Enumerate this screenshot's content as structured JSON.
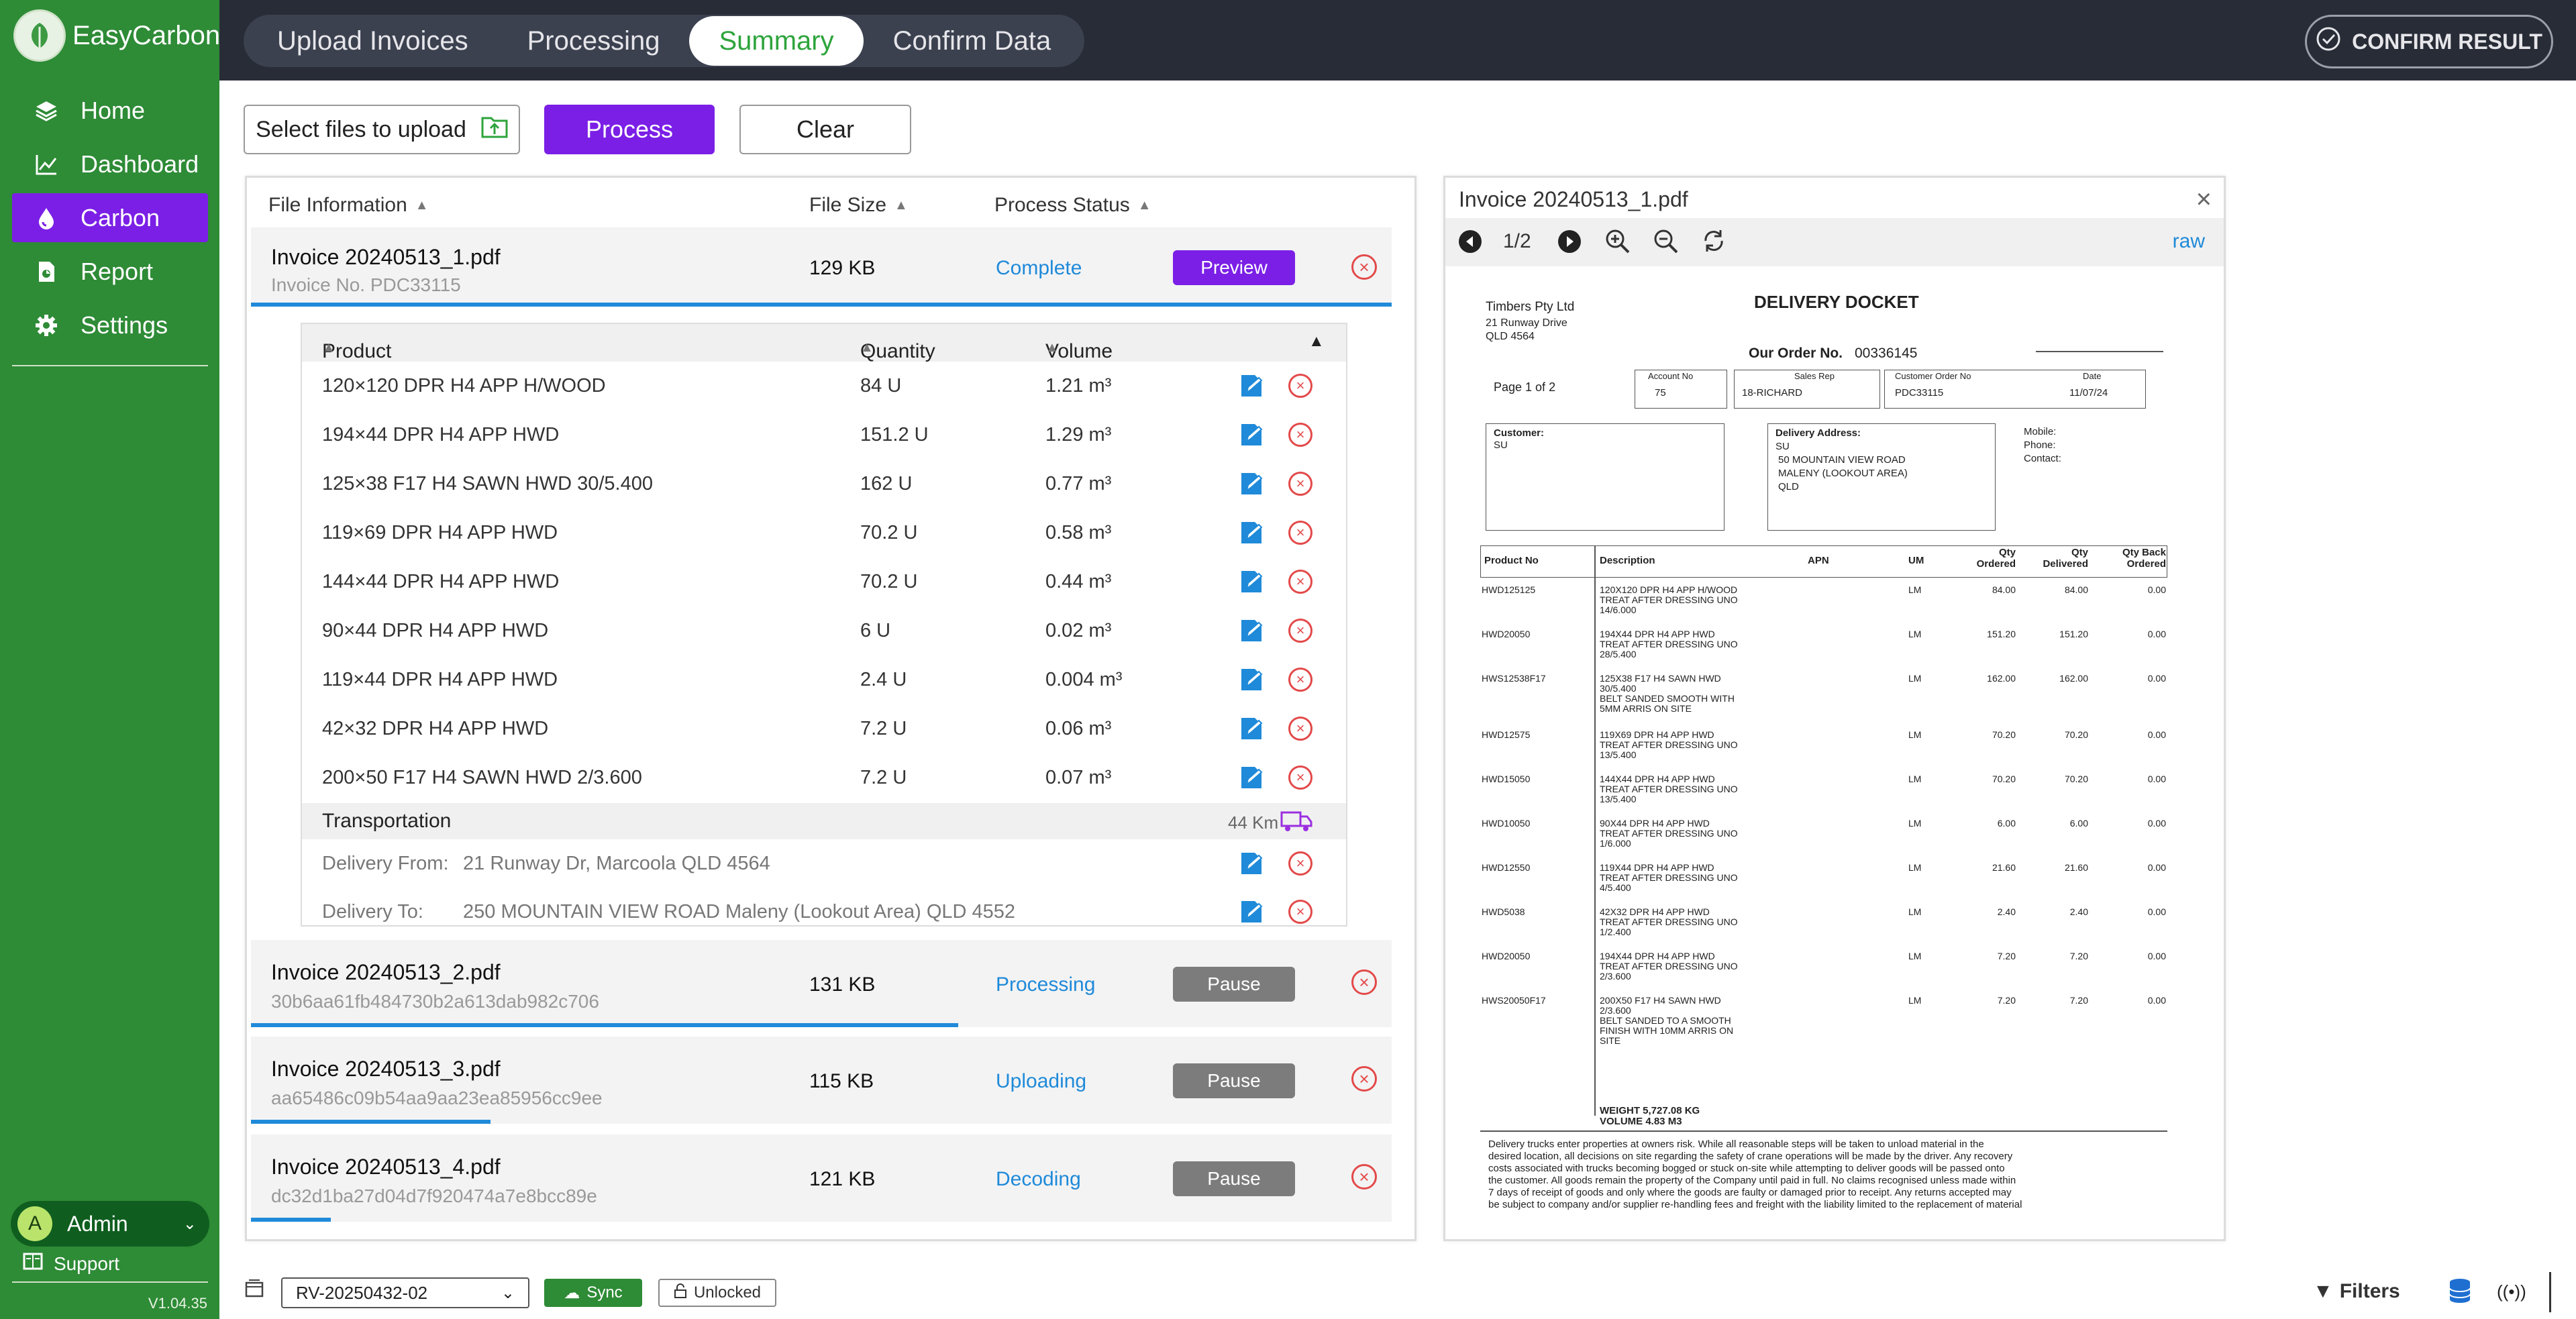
{
  "app": {
    "name": "EasyCarbon",
    "version": "V1.04.35"
  },
  "sidebar": {
    "items": [
      {
        "label": "Home"
      },
      {
        "label": "Dashboard"
      },
      {
        "label": "Carbon"
      },
      {
        "label": "Report"
      },
      {
        "label": "Settings"
      }
    ],
    "user": {
      "initial": "A",
      "name": "Admin"
    },
    "support": "Support"
  },
  "tabs": [
    {
      "label": "Upload Invoices"
    },
    {
      "label": "Processing"
    },
    {
      "label": "Summary"
    },
    {
      "label": "Confirm Data"
    }
  ],
  "confirm_result": "CONFIRM RESULT",
  "toolbar": {
    "select_files": "Select files to upload",
    "process": "Process",
    "clear": "Clear"
  },
  "files_table": {
    "headers": {
      "info": "File Information",
      "size": "File Size",
      "status": "Process Status"
    },
    "files": [
      {
        "name": "Invoice 20240513_1.pdf",
        "sub": "Invoice No. PDC33115",
        "size": "129 KB",
        "status": "Complete",
        "action": "Preview",
        "progress": 1.0
      },
      {
        "name": "Invoice 20240513_2.pdf",
        "sub": "30b6aa61fb484730b2a613dab982c706",
        "size": "131 KB",
        "status": "Processing",
        "action": "Pause",
        "progress": 0.62
      },
      {
        "name": "Invoice 20240513_3.pdf",
        "sub": "aa65486c09b54aa9aa23ea85956cc9ee",
        "size": "115 KB",
        "status": "Uploading",
        "action": "Pause",
        "progress": 0.21
      },
      {
        "name": "Invoice 20240513_4.pdf",
        "sub": "dc32d1ba27d04d7f920474a7e8bcc89e",
        "size": "121 KB",
        "status": "Decoding",
        "action": "Pause",
        "progress": 0.07
      }
    ]
  },
  "products": {
    "headers": {
      "product": "Product",
      "quantity": "Quantity",
      "volume": "Volume"
    },
    "rows": [
      {
        "product": "120×120 DPR H4 APP H/WOOD",
        "quantity": "84 U",
        "volume": "1.21 m³"
      },
      {
        "product": "194×44 DPR H4 APP HWD",
        "quantity": "151.2 U",
        "volume": "1.29 m³"
      },
      {
        "product": "125×38 F17 H4 SAWN HWD 30/5.400",
        "quantity": "162 U",
        "volume": "0.77 m³"
      },
      {
        "product": "119×69 DPR H4 APP HWD",
        "quantity": "70.2 U",
        "volume": "0.58 m³"
      },
      {
        "product": "144×44 DPR H4 APP HWD",
        "quantity": "70.2 U",
        "volume": "0.44 m³"
      },
      {
        "product": "90×44 DPR H4 APP HWD",
        "quantity": "6 U",
        "volume": "0.02 m³"
      },
      {
        "product": "119×44 DPR H4 APP HWD",
        "quantity": "2.4 U",
        "volume": "0.004 m³"
      },
      {
        "product": "42×32 DPR H4 APP HWD",
        "quantity": "7.2 U",
        "volume": "0.06 m³"
      },
      {
        "product": "200×50 F17 H4 SAWN HWD 2/3.600",
        "quantity": "7.2 U",
        "volume": "0.07 m³"
      }
    ],
    "transport": {
      "label": "Transportation",
      "distance": "44 Km"
    },
    "delivery_from": {
      "label": "Delivery From:",
      "value": "21 Runway Dr, Marcoola QLD 4564"
    },
    "delivery_to": {
      "label": "Delivery To:",
      "value": "250 MOUNTAIN VIEW ROAD Maleny (Lookout Area) QLD 4552"
    }
  },
  "preview": {
    "title": "Invoice 20240513_1.pdf",
    "page": "1/2",
    "raw": "raw",
    "doc": {
      "company": "Timbers Pty Ltd",
      "addr1": "21 Runway Drive",
      "addr2": "QLD  4564",
      "heading": "DELIVERY DOCKET",
      "order_label": "Our Order No.",
      "order_no": "00336145",
      "page": "Page 1 of 2",
      "acct_label": "Account No",
      "acct": "75",
      "rep_label": "Sales Rep",
      "rep": "18-RICHARD",
      "cust_order_label": "Customer Order No",
      "cust_order": "PDC33115",
      "date_label": "Date",
      "date": "11/07/24",
      "customer_label": "Customer:",
      "customer": "SU",
      "deliv_label": "Delivery Address:",
      "deliv_lines": [
        "SU",
        "50 MOUNTAIN VIEW ROAD",
        "MALENY (LOOKOUT AREA)",
        "QLD"
      ],
      "mobile": "Mobile:",
      "phone": "Phone:",
      "contact": "Contact:",
      "cols": [
        "Product No",
        "Description",
        "APN",
        "UM",
        "Qty Ordered",
        "Qty Delivered",
        "Qty Back Ordered"
      ],
      "lines": [
        {
          "code": "HWD125125",
          "desc": [
            "120X120 DPR H4 APP H/WOOD",
            "TREAT AFTER DRESSING UNO",
            "14/6.000"
          ],
          "um": "LM",
          "ord": "84.00",
          "del": "84.00",
          "back": "0.00"
        },
        {
          "code": "HWD20050",
          "desc": [
            "194X44 DPR H4 APP HWD",
            "TREAT AFTER DRESSING UNO",
            "28/5.400"
          ],
          "um": "LM",
          "ord": "151.20",
          "del": "151.20",
          "back": "0.00"
        },
        {
          "code": "HWS12538F17",
          "desc": [
            "125X38 F17 H4 SAWN HWD",
            "30/5.400",
            "BELT SANDED SMOOTH WITH",
            "5MM ARRIS ON SITE"
          ],
          "um": "LM",
          "ord": "162.00",
          "del": "162.00",
          "back": "0.00"
        },
        {
          "code": "HWD12575",
          "desc": [
            "119X69 DPR H4 APP HWD",
            "TREAT AFTER DRESSING UNO",
            "13/5.400"
          ],
          "um": "LM",
          "ord": "70.20",
          "del": "70.20",
          "back": "0.00"
        },
        {
          "code": "HWD15050",
          "desc": [
            "144X44 DPR H4 APP HWD",
            "TREAT AFTER DRESSING UNO",
            "13/5.400"
          ],
          "um": "LM",
          "ord": "70.20",
          "del": "70.20",
          "back": "0.00"
        },
        {
          "code": "HWD10050",
          "desc": [
            "90X44 DPR H4 APP HWD",
            "TREAT AFTER DRESSING UNO",
            "1/6.000"
          ],
          "um": "LM",
          "ord": "6.00",
          "del": "6.00",
          "back": "0.00"
        },
        {
          "code": "HWD12550",
          "desc": [
            "119X44 DPR H4 APP HWD",
            "TREAT AFTER DRESSING UNO",
            "4/5.400"
          ],
          "um": "LM",
          "ord": "21.60",
          "del": "21.60",
          "back": "0.00"
        },
        {
          "code": "HWD5038",
          "desc": [
            "42X32 DPR H4 APP HWD",
            "TREAT AFTER DRESSING UNO",
            "1/2.400"
          ],
          "um": "LM",
          "ord": "2.40",
          "del": "2.40",
          "back": "0.00"
        },
        {
          "code": "HWD20050",
          "desc": [
            "194X44 DPR H4 APP HWD",
            "TREAT AFTER DRESSING UNO",
            "2/3.600"
          ],
          "um": "LM",
          "ord": "7.20",
          "del": "7.20",
          "back": "0.00"
        },
        {
          "code": "HWS20050F17",
          "desc": [
            "200X50 F17 H4 SAWN HWD",
            "2/3.600",
            "BELT SANDED TO A SMOOTH",
            "FINISH WITH 10MM ARRIS ON",
            "SITE"
          ],
          "um": "LM",
          "ord": "7.20",
          "del": "7.20",
          "back": "0.00"
        }
      ],
      "weight": "WEIGHT  5,727.08 KG",
      "volume": "VOLUME      4.83 M3",
      "footer": [
        "Delivery trucks enter properties at owners risk.  While all reasonable steps will be taken to unload material in the",
        "desired location, all decisions on site regarding the safety of crane operations will be made by the driver.  Any recovery",
        "costs associated with trucks becoming bogged or stuck on-site while attempting to deliver goods will be passed onto",
        "the customer. All goods remain the property of the Company until paid in full. No claims recognised unless made within",
        "7 days of receipt of goods and only where the goods are faulty or damaged prior to receipt. Any returns accepted may",
        "be subject to company and/or supplier re-handling fees and freight with the liability limited to the replacement of material"
      ]
    }
  },
  "bottombar": {
    "record": "RV-20250432-02",
    "sync": "Sync",
    "lock": "Unlocked",
    "filters": "Filters"
  },
  "colors": {
    "sidebar": "#2e8b36",
    "accent": "#7b1fe6",
    "link": "#1f8ad9",
    "danger": "#e34a4a",
    "topbar": "#282c37"
  }
}
